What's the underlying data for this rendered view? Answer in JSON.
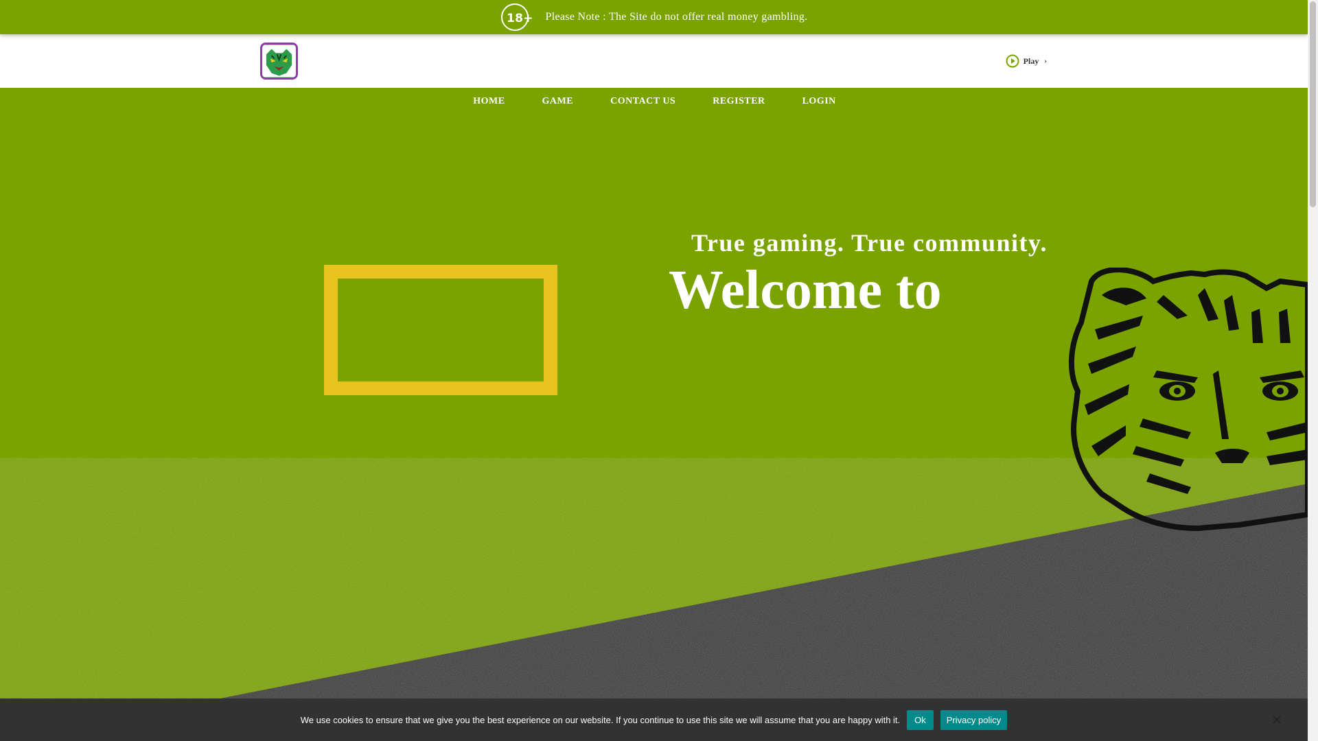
{
  "notice": {
    "age_badge": "18+",
    "text": "Please Note : The Site do not offer real money gambling."
  },
  "header": {
    "logo_icon": "tiger-logo-icon",
    "play_label": "Play",
    "play_chevron": "›"
  },
  "nav": {
    "items": [
      {
        "label": "HOME"
      },
      {
        "label": "GAME"
      },
      {
        "label": "CONTACT US"
      },
      {
        "label": "REGISTER"
      },
      {
        "label": "LOGIN"
      }
    ]
  },
  "hero": {
    "tagline": "True gaming. True community.",
    "welcome": "Welcome to"
  },
  "cookie": {
    "text": "We use cookies to ensure that we give you the best experience on our website. If you continue to use this site we will assume that you are happy with it.",
    "ok_label": "Ok",
    "privacy_label": "Privacy policy"
  },
  "colors": {
    "brand_green": "#7ba300",
    "frame_yellow": "#e8c31e",
    "cookie_bg": "#323232",
    "button_teal": "#008a8a",
    "logo_border": "#8b3fa0"
  }
}
